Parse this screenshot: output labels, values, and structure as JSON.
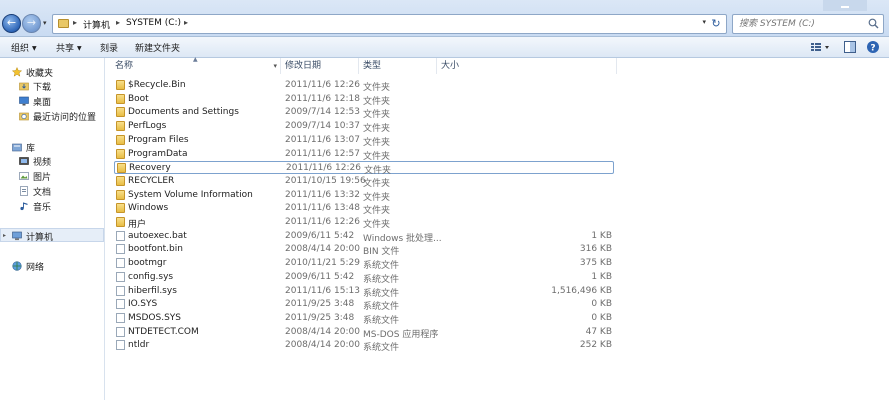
{
  "address": {
    "crumbs": [
      "计算机",
      "SYSTEM (C:)"
    ],
    "search_placeholder": "搜索 SYSTEM (C:)"
  },
  "toolbar": {
    "organize": "组织",
    "share": "共享",
    "burn": "刻录",
    "new_folder": "新建文件夹"
  },
  "sidebar": {
    "favorites": "收藏夹",
    "downloads": "下载",
    "desktop": "桌面",
    "recent": "最近访问的位置",
    "libraries": "库",
    "videos": "视频",
    "pictures": "图片",
    "documents": "文档",
    "music": "音乐",
    "computer": "计算机",
    "network": "网络"
  },
  "columns": {
    "name": "名称",
    "modified": "修改日期",
    "type": "类型",
    "size": "大小"
  },
  "files": [
    {
      "name": "$Recycle.Bin",
      "date": "2011/11/6 12:26",
      "type": "文件夹",
      "size": "",
      "icon": "folder-lock-icon"
    },
    {
      "name": "Boot",
      "date": "2011/11/6 12:18",
      "type": "文件夹",
      "size": "",
      "icon": "folder-icon"
    },
    {
      "name": "Documents and Settings",
      "date": "2009/7/14 12:53",
      "type": "文件夹",
      "size": "",
      "icon": "folder-lock-icon"
    },
    {
      "name": "PerfLogs",
      "date": "2009/7/14 10:37",
      "type": "文件夹",
      "size": "",
      "icon": "folder-icon"
    },
    {
      "name": "Program Files",
      "date": "2011/11/6 13:07",
      "type": "文件夹",
      "size": "",
      "icon": "folder-icon"
    },
    {
      "name": "ProgramData",
      "date": "2011/11/6 12:57",
      "type": "文件夹",
      "size": "",
      "icon": "folder-icon"
    },
    {
      "name": "Recovery",
      "date": "2011/11/6 12:26",
      "type": "文件夹",
      "size": "",
      "icon": "folder-icon"
    },
    {
      "name": "RECYCLER",
      "date": "2011/10/15 19:56",
      "type": "文件夹",
      "size": "",
      "icon": "folder-icon"
    },
    {
      "name": "System Volume Information",
      "date": "2011/11/6 13:32",
      "type": "文件夹",
      "size": "",
      "icon": "folder-icon"
    },
    {
      "name": "Windows",
      "date": "2011/11/6 13:48",
      "type": "文件夹",
      "size": "",
      "icon": "folder-icon"
    },
    {
      "name": "用户",
      "date": "2011/11/6 12:26",
      "type": "文件夹",
      "size": "",
      "icon": "folder-icon"
    },
    {
      "name": "autoexec.bat",
      "date": "2009/6/11 5:42",
      "type": "Windows 批处理...",
      "size": "1 KB",
      "icon": "file-icon"
    },
    {
      "name": "bootfont.bin",
      "date": "2008/4/14 20:00",
      "type": "BIN 文件",
      "size": "316 KB",
      "icon": "file-icon"
    },
    {
      "name": "bootmgr",
      "date": "2010/11/21 5:29",
      "type": "系统文件",
      "size": "375 KB",
      "icon": "file-icon"
    },
    {
      "name": "config.sys",
      "date": "2009/6/11 5:42",
      "type": "系统文件",
      "size": "1 KB",
      "icon": "file-icon"
    },
    {
      "name": "hiberfil.sys",
      "date": "2011/11/6 15:13",
      "type": "系统文件",
      "size": "1,516,496 KB",
      "icon": "file-icon"
    },
    {
      "name": "IO.SYS",
      "date": "2011/9/25 3:48",
      "type": "系统文件",
      "size": "0 KB",
      "icon": "file-icon"
    },
    {
      "name": "MSDOS.SYS",
      "date": "2011/9/25 3:48",
      "type": "系统文件",
      "size": "0 KB",
      "icon": "file-icon"
    },
    {
      "name": "NTDETECT.COM",
      "date": "2008/4/14 20:00",
      "type": "MS-DOS 应用程序",
      "size": "47 KB",
      "icon": "file-icon"
    },
    {
      "name": "ntldr",
      "date": "2008/4/14 20:00",
      "type": "系统文件",
      "size": "252 KB",
      "icon": "file-icon"
    }
  ],
  "selected_index": 6
}
